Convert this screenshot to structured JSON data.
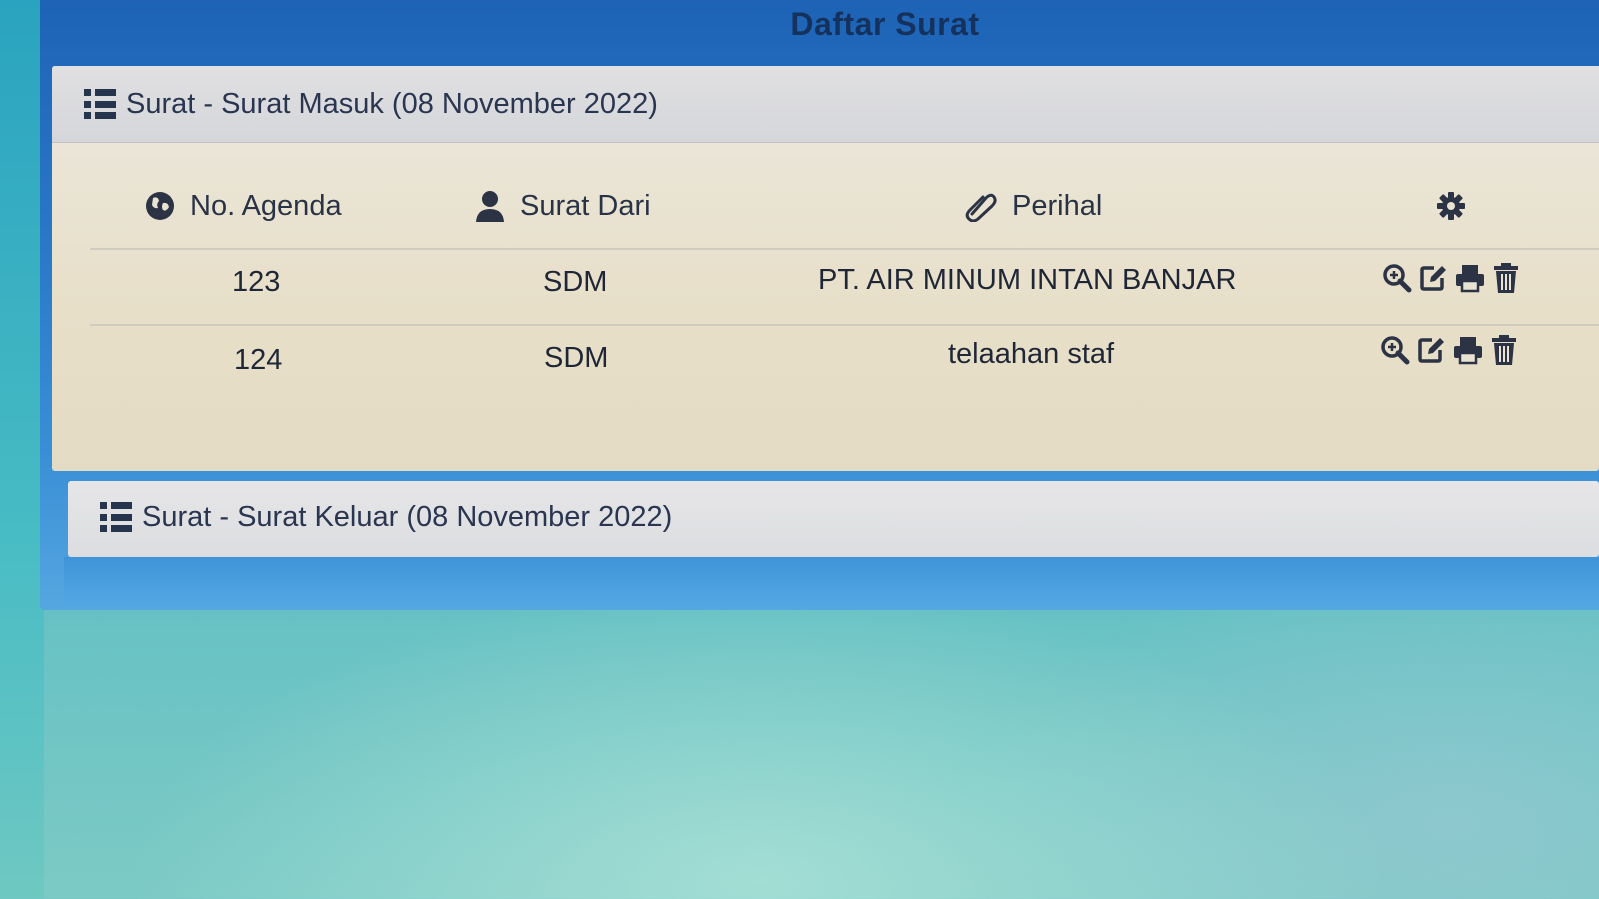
{
  "window": {
    "title": "Daftar Surat"
  },
  "incoming": {
    "heading": "Surat - Surat Masuk (08 November 2022)",
    "columns": {
      "agenda": "No. Agenda",
      "from": "Surat Dari",
      "subject": "Perihal"
    },
    "rows": [
      {
        "agenda": "123",
        "from": "SDM",
        "subject": "PT. AIR MINUM INTAN BANJAR"
      },
      {
        "agenda": "124",
        "from": "SDM",
        "subject": "telaahan staf"
      }
    ],
    "row_actions": [
      "zoom-icon",
      "edit-icon",
      "print-icon",
      "trash-icon"
    ]
  },
  "outgoing": {
    "heading": "Surat - Surat Keluar (08 November 2022)"
  },
  "colors": {
    "window_blue": "#2a78c8",
    "title_text": "#15325e",
    "panel_bg": "#e7dfc8",
    "heading_bg": "#d9dadd",
    "text_dark": "#1f2635"
  }
}
